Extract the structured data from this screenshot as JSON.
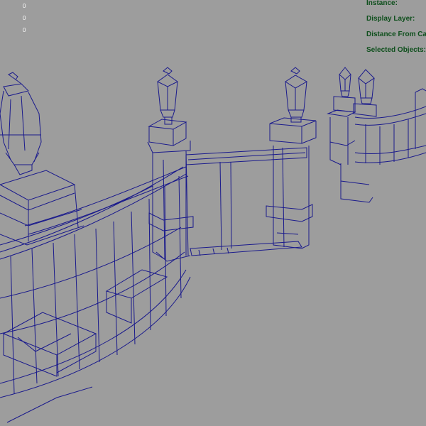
{
  "heads_up_display": {
    "labels": [
      "Instance:",
      "Display Layer:",
      "Distance From Ca",
      "Selected Objects:"
    ]
  },
  "poly_counts": [
    "0",
    "0",
    "0"
  ],
  "colors": {
    "viewport_background": "#9d9d9d",
    "wireframe": "#1a1a8c",
    "hud_text": "#0e4f1c",
    "counter_text": "#ffffff"
  }
}
